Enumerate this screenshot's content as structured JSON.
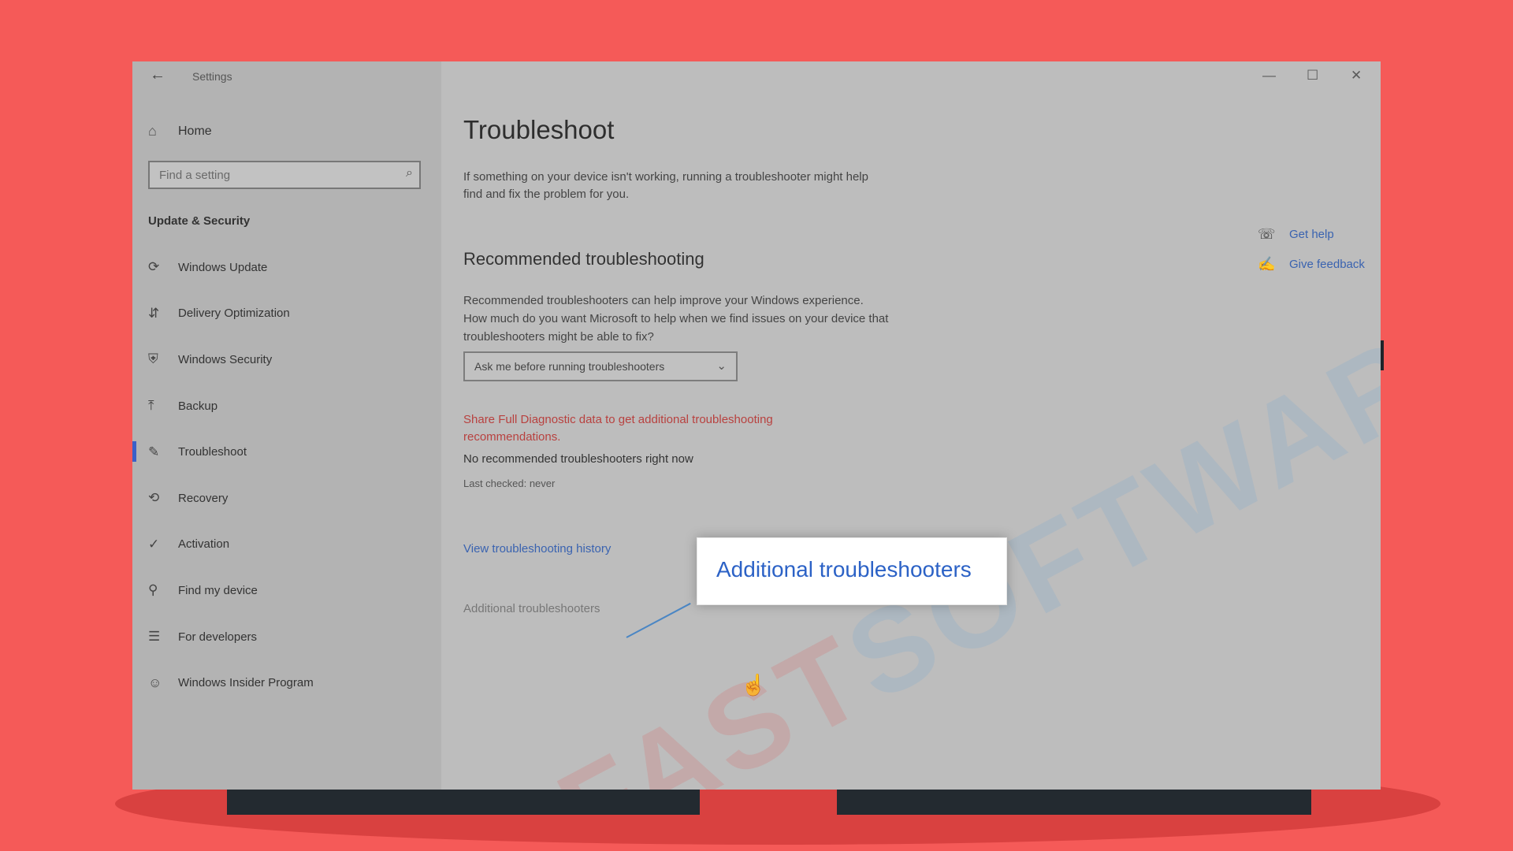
{
  "window": {
    "title": "Settings",
    "back_icon": "←",
    "minimize_icon": "—",
    "maximize_icon": "☐",
    "close_icon": "✕"
  },
  "sidebar": {
    "home": {
      "icon": "⌂",
      "label": "Home"
    },
    "search": {
      "placeholder": "Find a setting",
      "icon": "⌕"
    },
    "section_title": "Update & Security",
    "items": [
      {
        "icon": "⟳",
        "label": "Windows Update"
      },
      {
        "icon": "⇵",
        "label": "Delivery Optimization"
      },
      {
        "icon": "⛨",
        "label": "Windows Security"
      },
      {
        "icon": "⤒",
        "label": "Backup"
      },
      {
        "icon": "✎",
        "label": "Troubleshoot",
        "active": true
      },
      {
        "icon": "⟲",
        "label": "Recovery"
      },
      {
        "icon": "✓",
        "label": "Activation"
      },
      {
        "icon": "⚲",
        "label": "Find my device"
      },
      {
        "icon": "☰",
        "label": "For developers"
      },
      {
        "icon": "☺",
        "label": "Windows Insider Program"
      }
    ]
  },
  "main": {
    "title": "Troubleshoot",
    "intro": "If something on your device isn't working, running a troubleshooter might help find and fix the problem for you.",
    "recommended_heading": "Recommended troubleshooting",
    "recommended_text": "Recommended troubleshooters can help improve your Windows experience. How much do you want Microsoft to help when we find issues on your device that troubleshooters might be able to fix?",
    "dropdown_value": "Ask me before running troubleshooters",
    "dropdown_icon": "⌄",
    "diagnostic_link": "Share Full Diagnostic data to get additional troubleshooting recommendations.",
    "no_recommended": "No recommended troubleshooters right now",
    "last_checked": "Last checked: never",
    "history_link": "View troubleshooting history",
    "additional_link": "Additional troubleshooters"
  },
  "callout": {
    "label": "Additional troubleshooters"
  },
  "help": {
    "get_help": {
      "icon": "☏",
      "label": "Get help"
    },
    "feedback": {
      "icon": "✍",
      "label": "Give feedback"
    }
  },
  "watermark": {
    "part1": "FAST",
    "part2": "SOFTWARES"
  },
  "colors": {
    "background": "#f55a58",
    "link": "#3a63b0",
    "diagnostic_link": "#b8413f",
    "callout_text": "#2c62c6",
    "active_indicator": "#3a60c8"
  }
}
